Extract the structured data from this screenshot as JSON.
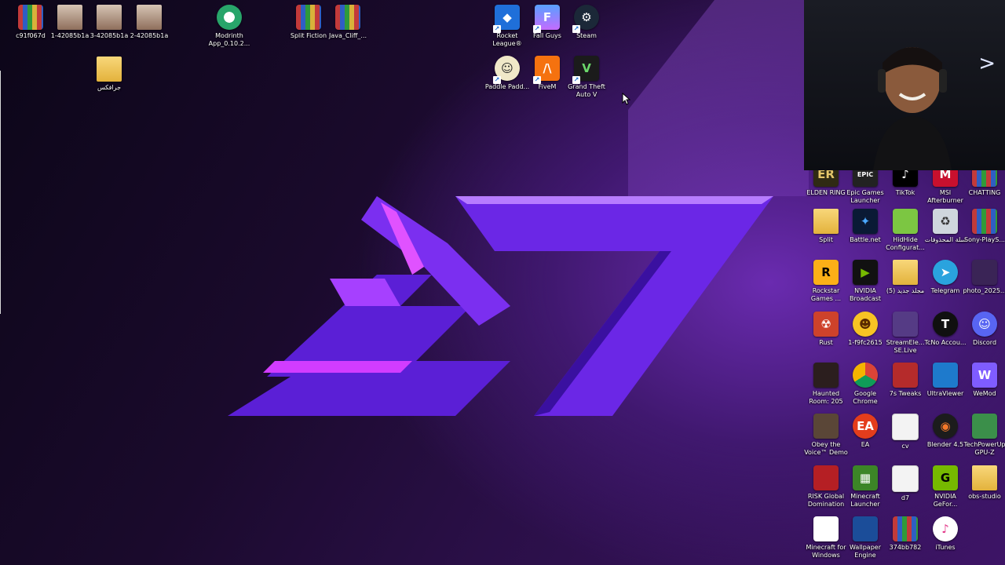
{
  "desktop": {
    "top_icons": [
      {
        "label": "c91f067d",
        "icon": "winrar-icon"
      },
      {
        "label": "1-42085b1a",
        "icon": "photo-icon"
      },
      {
        "label": "3-42085b1a",
        "icon": "photo-icon"
      },
      {
        "label": "2-42085b1a",
        "icon": "photo-icon"
      },
      {
        "label": "Modrinth App_0.10.2...",
        "icon": "modrinth-icon"
      },
      {
        "label": "Split Fiction",
        "icon": "winrar-icon"
      },
      {
        "label": "Java_Cliff_...",
        "icon": "winrar-icon"
      },
      {
        "label": "جرافكس",
        "icon": "folder-icon"
      }
    ],
    "center_icons": [
      {
        "label": "Rocket League®",
        "icon": "rocket-league-icon"
      },
      {
        "label": "Fall Guys",
        "icon": "fall-guys-icon"
      },
      {
        "label": "Steam",
        "icon": "steam-icon"
      },
      {
        "label": "Paddle Padd...",
        "icon": "paddle-icon"
      },
      {
        "label": "FiveM",
        "icon": "fivem-icon"
      },
      {
        "label": "Grand Theft Auto V",
        "icon": "gta-icon"
      }
    ],
    "right_icons": [
      {
        "label": "ELDEN RING",
        "icon": "elden-ring-icon"
      },
      {
        "label": "Epic Games Launcher",
        "icon": "epic-games-icon"
      },
      {
        "label": "TikTok",
        "icon": "tiktok-icon"
      },
      {
        "label": "MSI Afterburner",
        "icon": "msi-icon"
      },
      {
        "label": "CHATTING",
        "icon": "winrar-icon"
      },
      {
        "label": "Split",
        "icon": "folder-icon"
      },
      {
        "label": "Battle.net",
        "icon": "battlenet-icon"
      },
      {
        "label": "HidHide Configurat...",
        "icon": "hidhide-icon"
      },
      {
        "label": "سلة المحذوفات",
        "icon": "recycle-bin-icon"
      },
      {
        "label": "Sony-PlayS...",
        "icon": "winrar-icon"
      },
      {
        "label": "Rockstar Games ...",
        "icon": "rockstar-icon"
      },
      {
        "label": "NVIDIA Broadcast",
        "icon": "nvidia-icon"
      },
      {
        "label": "مجلد جديد (5)",
        "icon": "folder-icon"
      },
      {
        "label": "Telegram",
        "icon": "telegram-icon"
      },
      {
        "label": "photo_2025...",
        "icon": "image-icon"
      },
      {
        "label": "Rust",
        "icon": "rust-icon"
      },
      {
        "label": "1-f9fc2615",
        "icon": "emoji-icon"
      },
      {
        "label": "StreamEle... SE.Live",
        "icon": "streamelements-icon"
      },
      {
        "label": "TcNo Accou...",
        "icon": "tcno-icon"
      },
      {
        "label": "Discord",
        "icon": "discord-icon"
      },
      {
        "label": "Haunted Room: 205",
        "icon": "haunted-icon"
      },
      {
        "label": "Google Chrome",
        "icon": "chrome-icon"
      },
      {
        "label": "7s Tweaks",
        "icon": "tweaks-icon"
      },
      {
        "label": "UltraViewer",
        "icon": "ultraviewer-icon"
      },
      {
        "label": "WeMod",
        "icon": "wemod-icon"
      },
      {
        "label": "Obey the Voice™ Demo",
        "icon": "obey-icon"
      },
      {
        "label": "EA",
        "icon": "ea-icon"
      },
      {
        "label": "cv",
        "icon": "document-icon"
      },
      {
        "label": "Blender 4.5",
        "icon": "blender-icon"
      },
      {
        "label": "TechPowerUp GPU-Z",
        "icon": "gpuz-icon"
      },
      {
        "label": "RISK Global Domination",
        "icon": "risk-icon"
      },
      {
        "label": "Minecraft Launcher",
        "icon": "minecraft-icon"
      },
      {
        "label": "d7",
        "icon": "document-icon"
      },
      {
        "label": "NVIDIA GeFor...",
        "icon": "geforce-icon"
      },
      {
        "label": "obs-studio",
        "icon": "folder-icon"
      },
      {
        "label": "Minecraft for Windows",
        "icon": "page-icon"
      },
      {
        "label": "Wallpaper Engine",
        "icon": "wallpaper-engine-icon"
      },
      {
        "label": "374bb782",
        "icon": "winrar-icon"
      },
      {
        "label": "iTunes",
        "icon": "itunes-icon"
      }
    ]
  },
  "colors": {
    "accent": "#7a2cf0",
    "magenta": "#d23cff",
    "background": "#1a0a2c"
  }
}
